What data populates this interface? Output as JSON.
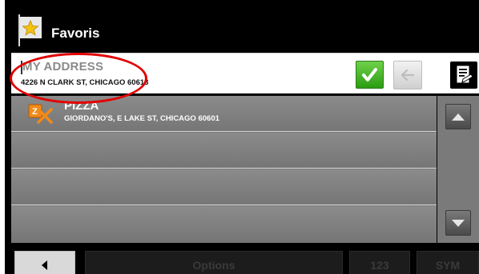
{
  "header": {
    "title": "Favoris",
    "icon": "favorites-flag-star-icon"
  },
  "input": {
    "placeholder": "MY ADDRESS",
    "value": "4226 N CLARK ST, CHICAGO 60613",
    "buttons": [
      "confirm-check-icon",
      "back-arrow-icon",
      "document-edit-icon"
    ]
  },
  "list": {
    "items": [
      {
        "title": "PIZZA",
        "subtitle": "GIORDANO'S, E LAKE ST, CHICAGO 60601",
        "icon": "pizza-poi-icon"
      },
      {
        "title": "",
        "subtitle": ""
      },
      {
        "title": "",
        "subtitle": ""
      },
      {
        "title": "",
        "subtitle": ""
      }
    ]
  },
  "toolbar": {
    "back": "left-arrow-icon",
    "options_label": "Options",
    "numbers_label": "123",
    "symbols_label": "SYM"
  },
  "colors": {
    "accent_green": "#2b9d12",
    "highlight_red": "#e10000"
  }
}
